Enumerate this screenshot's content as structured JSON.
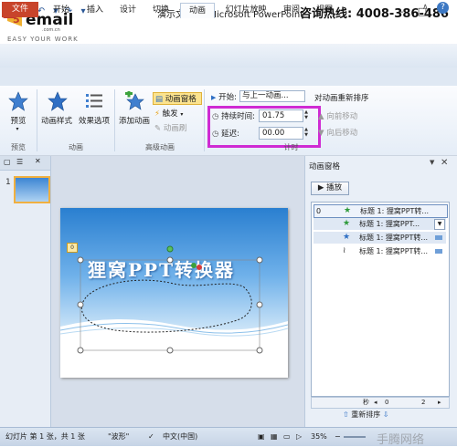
{
  "watermark": {
    "logo_text": "email",
    "logo_sub": ".com.cn",
    "tagline": "EASY YOUR WORK",
    "hotline": "咨询热线: 4008-386-486",
    "bottom_text": "手腾网络"
  },
  "window": {
    "title": "演示文稿1 - Microsoft PowerPoint",
    "app_icon": "P"
  },
  "tabs": [
    {
      "label": "文件"
    },
    {
      "label": "开始"
    },
    {
      "label": "插入"
    },
    {
      "label": "设计"
    },
    {
      "label": "切换"
    },
    {
      "label": "动画"
    },
    {
      "label": "幻灯片放映"
    },
    {
      "label": "审阅"
    },
    {
      "label": "视图"
    }
  ],
  "active_tab": "动画",
  "ribbon": {
    "preview": {
      "button": "预览",
      "group": "预览"
    },
    "animation": {
      "style_button": "动画样式",
      "effect_button": "效果选项",
      "group": "动画"
    },
    "advanced": {
      "add_button": "添加动画",
      "pane_button": "动画窗格",
      "trigger_button": "触发",
      "painter_button": "动画刷",
      "group": "高级动画"
    },
    "timing": {
      "start_label": "开始:",
      "start_value": "与上一动画...",
      "duration_label": "持续时间:",
      "duration_value": "01.75",
      "delay_label": "延迟:",
      "delay_value": "00.00",
      "reorder_title": "对动画重新排序",
      "move_earlier": "向前移动",
      "move_later": "向后移动",
      "group": "计时"
    }
  },
  "thumbnails": {
    "slide_number": "1"
  },
  "slide": {
    "title": "狸窝PPT转换器",
    "anim_tag": "0"
  },
  "animation_pane": {
    "title": "动画窗格",
    "play": "播放",
    "items": [
      {
        "num": "0",
        "text": "标题 1: 狸窝PPT转...",
        "icon": "star-effect-icon"
      },
      {
        "num": "",
        "text": "标题 1: 狸窝PPT...",
        "icon": "star-effect-icon"
      },
      {
        "num": "",
        "text": "标题 1: 狸窝PPT转...",
        "icon": "star-effect-icon"
      },
      {
        "num": "",
        "text": "标题 1: 狸窝PPT转...",
        "icon": "motion-path-icon"
      }
    ],
    "timeline_second_label": "秒",
    "timeline_start": "0",
    "timeline_end": "2",
    "reorder_label": "重新排序"
  },
  "statusbar": {
    "slide_info": "幻灯片 第 1 张，共 1 张",
    "theme": "\"波形\"",
    "language": "中文(中国)",
    "zoom": "35%"
  }
}
